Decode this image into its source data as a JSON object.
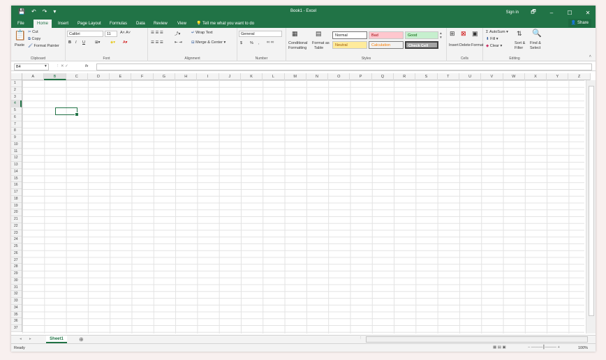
{
  "title": "Book1 - Excel",
  "qat": {
    "save": "💾",
    "undo": "↶",
    "redo": "↷",
    "more": "▾"
  },
  "account": {
    "signin": "Sign in",
    "ribbon_opts": "🗗",
    "minimize": "–",
    "maximize": "☐",
    "close": "✕"
  },
  "tabs": [
    "File",
    "Home",
    "Insert",
    "Page Layout",
    "Formulas",
    "Data",
    "Review",
    "View"
  ],
  "tell": "Tell me what you want to do",
  "share": "Share",
  "clipboard": {
    "paste": "Paste",
    "cut": "Cut",
    "copy": "Copy",
    "painter": "Format Painter",
    "label": "Clipboard"
  },
  "font": {
    "name": "Calibri",
    "size": "11",
    "bold": "B",
    "italic": "I",
    "underline": "U",
    "label": "Font"
  },
  "alignment": {
    "wrap": "Wrap Text",
    "merge": "Merge & Center",
    "label": "Alignment"
  },
  "number": {
    "format": "General",
    "currency": "$",
    "percent": "%",
    "comma": ",",
    "label": "Number"
  },
  "styles": {
    "cond1": "Conditional",
    "cond2": "Formatting",
    "table1": "Format as",
    "table2": "Table",
    "normal": "Normal",
    "bad": "Bad",
    "good": "Good",
    "neutral": "Neutral",
    "calc": "Calculation",
    "check": "Check Cell",
    "label": "Styles"
  },
  "cells_grp": {
    "insert": "Insert",
    "delete": "Delete",
    "format": "Format",
    "label": "Cells"
  },
  "editing": {
    "autosum": "AutoSum",
    "fill": "Fill",
    "clear": "Clear",
    "sort1": "Sort &",
    "sort2": "Filter",
    "find1": "Find &",
    "find2": "Select",
    "label": "Editing"
  },
  "formula": {
    "namebox": "B4",
    "fx": "fx",
    "value": ""
  },
  "columns": [
    "A",
    "B",
    "C",
    "D",
    "E",
    "F",
    "G",
    "H",
    "I",
    "J",
    "K",
    "L",
    "M",
    "N",
    "O",
    "P",
    "Q",
    "R",
    "S",
    "T",
    "U",
    "V",
    "W",
    "X",
    "Y",
    "Z"
  ],
  "rows": [
    "1",
    "2",
    "3",
    "4",
    "5",
    "6",
    "7",
    "8",
    "9",
    "10",
    "11",
    "12",
    "13",
    "14",
    "15",
    "16",
    "17",
    "18",
    "19",
    "20",
    "21",
    "22",
    "23",
    "24",
    "25",
    "26",
    "27",
    "28",
    "29",
    "30",
    "31",
    "32",
    "33",
    "34",
    "35",
    "36",
    "37"
  ],
  "sheet": "Sheet1",
  "status": {
    "ready": "Ready",
    "zoom": "100%"
  },
  "colors": {
    "accent": "#217346"
  }
}
